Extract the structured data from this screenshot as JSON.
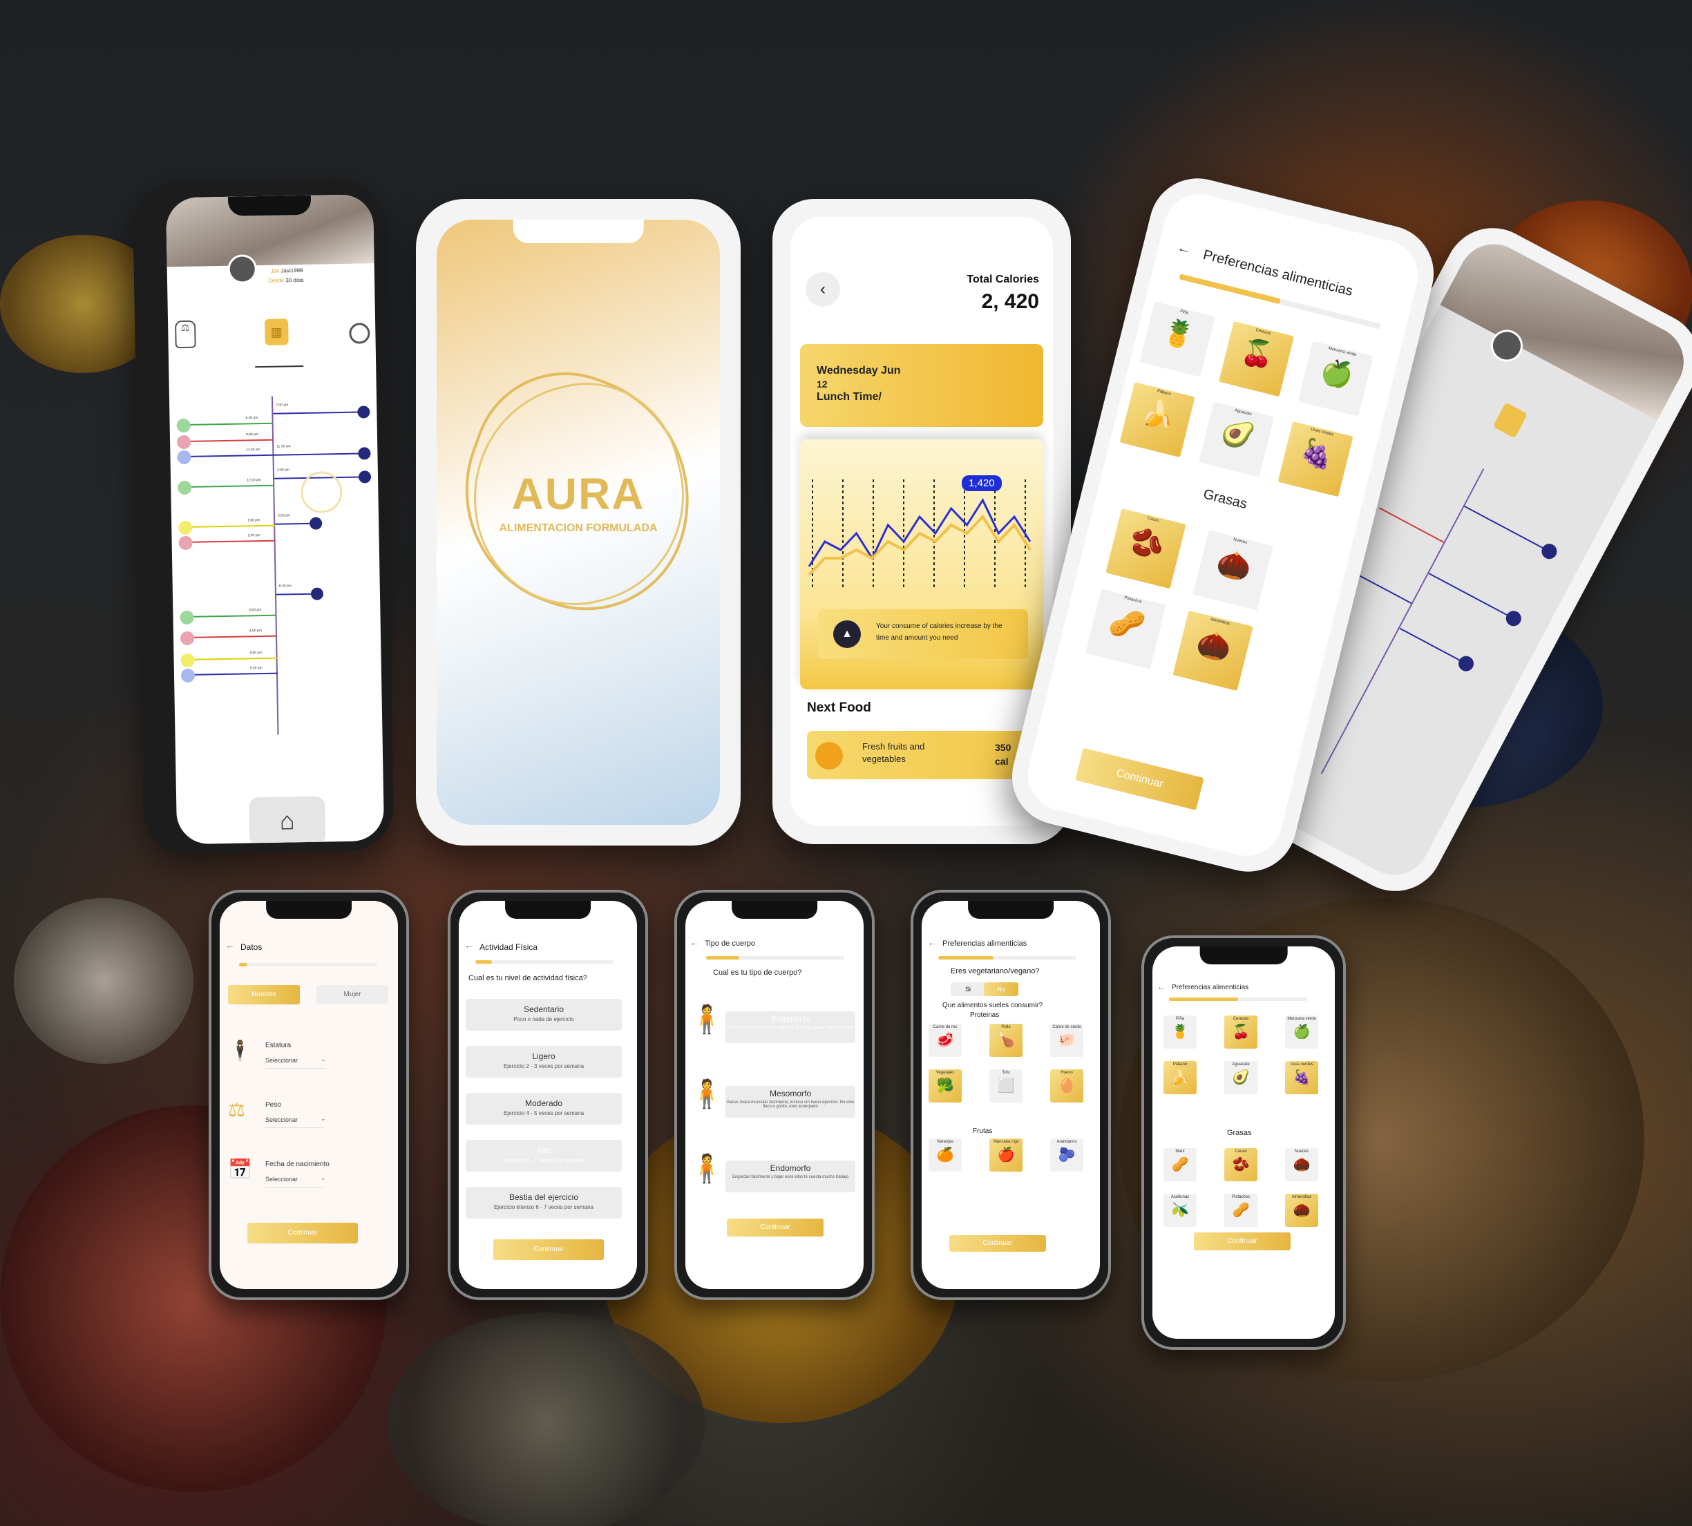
{
  "profile": {
    "user_label": "Jav",
    "user_value": "Javi1998",
    "since_label": "Desde",
    "since_value": "30 días"
  },
  "splash": {
    "brand": "AURA",
    "tagline": "ALIMENTACION FORMULADA"
  },
  "calories": {
    "total_label": "Total Calories",
    "total_value": "2, 420",
    "date_line1": "Wednesday Jun",
    "date_line2": "12",
    "meal": "Lunch Time/",
    "peak_label": "1,420",
    "info_text": "Your consume of calories increase by the time and amount you need",
    "next_food_title": "Next Food",
    "next_food_name": "Fresh fruits and vegetables",
    "next_food_cal_value": "350",
    "next_food_cal_unit": "cal"
  },
  "chart_data": {
    "type": "line",
    "series": [
      {
        "values": [
          2,
          5,
          4,
          6,
          3,
          7,
          5,
          8,
          6,
          9,
          7,
          10,
          6,
          8,
          5
        ]
      },
      {
        "values": [
          1,
          3,
          3,
          4,
          3,
          5,
          4,
          6,
          5,
          7,
          6,
          8,
          5,
          7,
          4
        ]
      }
    ],
    "peak_label": "1,420"
  },
  "prefs_large": {
    "title": "Preferencias alimenticias",
    "items": [
      "Piña",
      "Cerezas",
      "Manzana verde",
      "Plátano",
      "Aguacate",
      "Uvas verdes"
    ],
    "fats_title": "Grasas",
    "fats": [
      "Cacao",
      "Nueces",
      "Pistachos",
      "Almendras"
    ],
    "continue": "Continuar"
  },
  "datos": {
    "title": "Datos",
    "male": "Hombre",
    "female": "Mujer",
    "fields": [
      {
        "label": "Estatura",
        "value": "Seleccionar"
      },
      {
        "label": "Peso",
        "value": "Seleccionar"
      },
      {
        "label": "Fecha de nacimiento",
        "value": "Seleccionar"
      }
    ],
    "continue": "Continuar"
  },
  "actividad": {
    "title": "Actividad Física",
    "question": "Cual es tu nivel de actividad física?",
    "options": [
      {
        "name": "Sedentario",
        "desc": "Poco o nada de ejercicio"
      },
      {
        "name": "Ligero",
        "desc": "Ejercicio 2 - 3 veces por semana"
      },
      {
        "name": "Moderado",
        "desc": "Ejercicio 4 - 5 veces por semana"
      },
      {
        "name": "Alto",
        "desc": "Ejercicio 6 - 7 veces por semana"
      },
      {
        "name": "Bestia del ejercicio",
        "desc": "Ejercicio intenso 6 - 7 veces por semana"
      }
    ],
    "continue": "Continuar"
  },
  "cuerpo": {
    "title": "Tipo de cuerpo",
    "question": "Cual es tu tipo de cuerpo?",
    "options": [
      {
        "name": "Ectomorfo",
        "desc": "Cuerpo lo que sea pero no engordo. Te cuesta ganar masa muscular"
      },
      {
        "name": "Mesomorfo",
        "desc": "Ganas masa muscular fácilmente, incluso sin hacer ejercicio. No eres flaco o gordo, eres acuerpado"
      },
      {
        "name": "Endomorfo",
        "desc": "Engordas fácilmente y bajar esos kilos te cuesta mucho trabajo"
      }
    ],
    "continue": "Continuar"
  },
  "veg": {
    "title": "Preferencias alimenticias",
    "question": "Eres vegetariano/vegano?",
    "yes": "Si",
    "no": "No",
    "q2": "Que alimentos sueles consumir?",
    "proteins_title": "Proteinas",
    "proteins": [
      "Carne de res",
      "Pollo",
      "Carne de cerdo",
      "Vegetales",
      "Tofu",
      "Huevo"
    ],
    "fruits_title": "Frutas",
    "fruits": [
      "Naranjas",
      "Manzana roja",
      "Arandanos"
    ],
    "continue": "Continuar"
  },
  "prefs_small": {
    "title": "Preferencias alimenticias",
    "items": [
      "Piña",
      "Cerezas",
      "Manzana verde",
      "Plátano",
      "Aguacate",
      "Uvas verdes"
    ],
    "fats_title": "Grasas",
    "fats": [
      "Maní",
      "Cacao",
      "Nueces",
      "Aceitunas",
      "Pistachos",
      "Almendras"
    ],
    "continue": "Continuar"
  },
  "timeline_times": [
    "7:00 am",
    "8:00 am",
    "9:00 am",
    "11:30 am",
    "12:00 pm",
    "1:00 pm",
    "2:00 pm",
    "3:00 pm",
    "4:00 pm",
    "5:00 pm",
    "5:30 pm",
    "6:00 pm",
    "6:30 pm",
    "7:00 pm"
  ]
}
